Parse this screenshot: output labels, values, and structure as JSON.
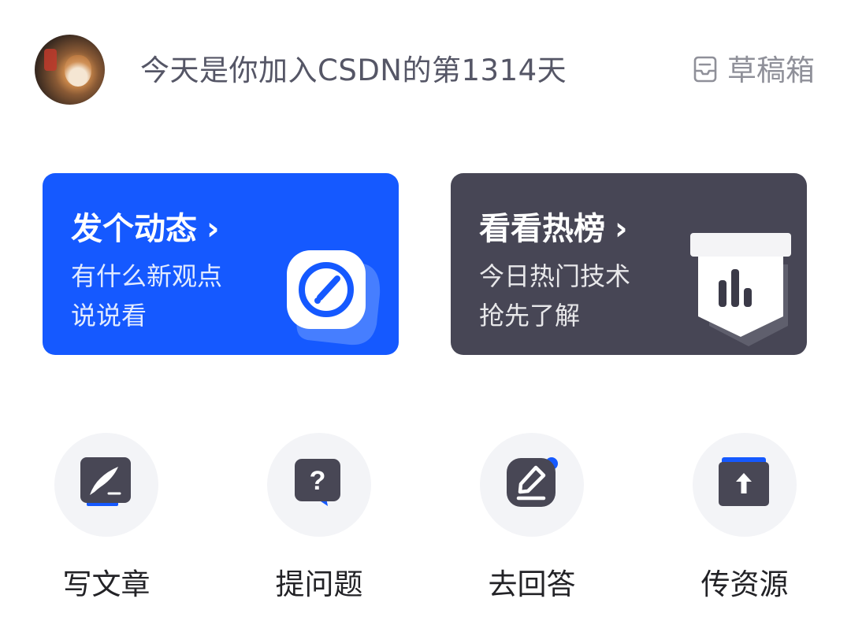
{
  "header": {
    "welcome_text": "今天是你加入CSDN的第1314天",
    "drafts_label": "草稿箱",
    "drafts_icon": "drafts-box-icon"
  },
  "cards": {
    "post": {
      "title": "发个动态",
      "chevron": "›",
      "line1": "有什么新观点",
      "line2": "说说看",
      "icon": "compose-pen-icon",
      "color": "#1559ff"
    },
    "hot": {
      "title": "看看热榜",
      "chevron": "›",
      "line1": "今日热门技术",
      "line2": "抢先了解",
      "icon": "trending-chart-icon",
      "color": "#474655"
    }
  },
  "actions": [
    {
      "label": "写文章",
      "icon": "quill-article-icon"
    },
    {
      "label": "提问题",
      "icon": "question-bubble-icon"
    },
    {
      "label": "去回答",
      "icon": "pencil-answer-icon"
    },
    {
      "label": "传资源",
      "icon": "upload-resource-icon"
    }
  ],
  "colors": {
    "accent_blue": "#1559ff",
    "dark_card": "#474655",
    "icon_dark": "#484755",
    "circle_bg": "#f3f4f7"
  }
}
